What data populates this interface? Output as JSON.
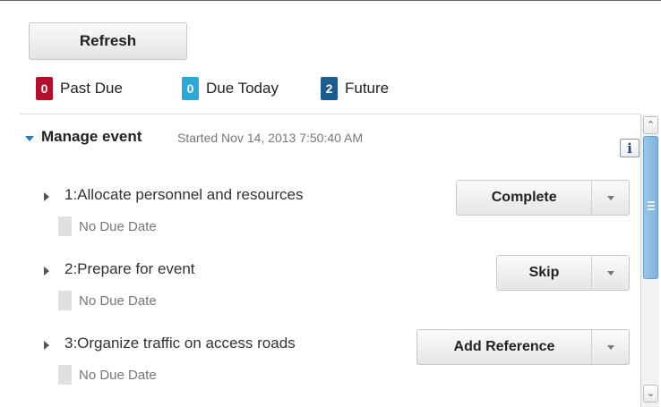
{
  "toolbar": {
    "refresh_label": "Refresh"
  },
  "status": [
    {
      "count": "0",
      "label": "Past Due",
      "color": "#b3102d"
    },
    {
      "count": "0",
      "label": "Due Today",
      "color": "#2aa8d6"
    },
    {
      "count": "2",
      "label": "Future",
      "color": "#1c5c8f"
    }
  ],
  "event": {
    "title": "Manage event",
    "started": "Started Nov 14, 2013 7:50:40 AM",
    "info_label": "i"
  },
  "tasks": [
    {
      "title": "1:Allocate personnel and resources",
      "due": "No Due Date",
      "action": "Complete"
    },
    {
      "title": "2:Prepare for event",
      "due": "No Due Date",
      "action": "Skip"
    },
    {
      "title": "3:Organize traffic on access roads",
      "due": "No Due Date",
      "action": "Add Reference"
    }
  ],
  "icons": {
    "event_toggle": "chevron-down-icon",
    "task_toggle": "chevron-right-icon",
    "dropdown": "caret-down-icon",
    "info": "info-icon"
  },
  "scrollbar": {
    "position": 0.0
  }
}
